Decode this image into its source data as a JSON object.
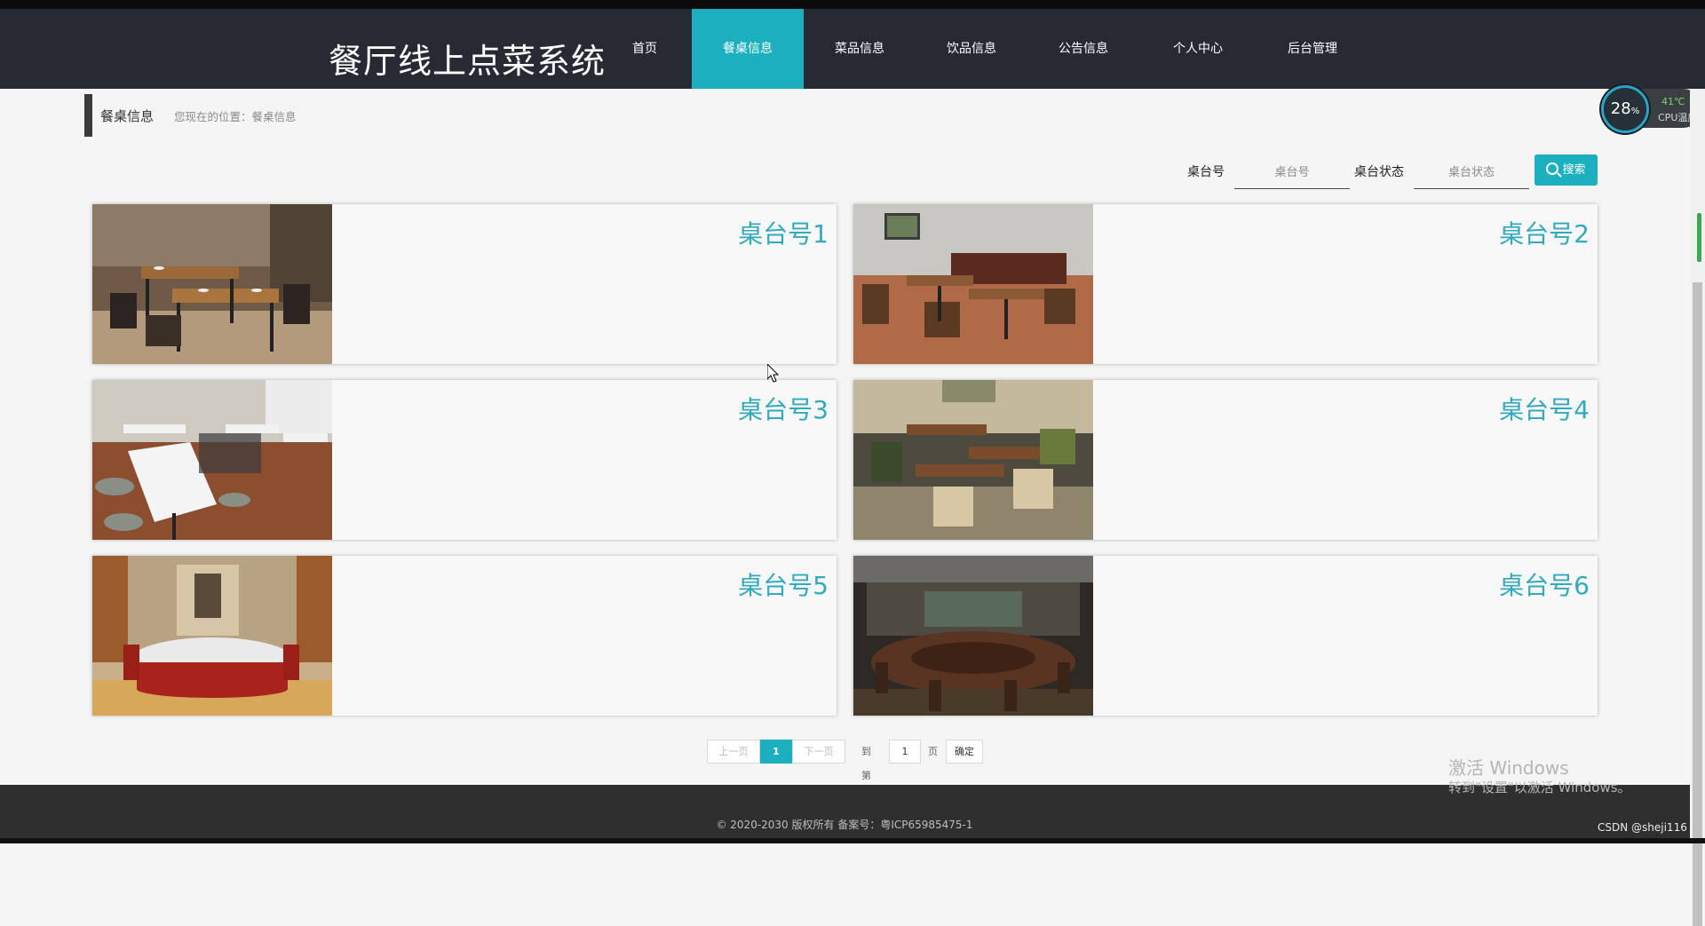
{
  "header": {
    "brand": "餐厅线上点菜系统",
    "nav": [
      "首页",
      "餐桌信息",
      "菜品信息",
      "饮品信息",
      "公告信息",
      "个人中心",
      "后台管理"
    ],
    "active_index": 1
  },
  "breadcrumb": {
    "title": "餐桌信息",
    "location": "您现在的位置：餐桌信息"
  },
  "search": {
    "table_label": "桌台号",
    "table_placeholder": "桌台号",
    "status_label": "桌台状态",
    "status_placeholder": "桌台状态",
    "button_label": "搜索",
    "button_icon": "search-icon"
  },
  "tables": [
    {
      "name": "桌台号1"
    },
    {
      "name": "桌台号2"
    },
    {
      "name": "桌台号3"
    },
    {
      "name": "桌台号4"
    },
    {
      "name": "桌台号5"
    },
    {
      "name": "桌台号6"
    }
  ],
  "pagination": {
    "prev": "上一页",
    "current": "1",
    "next": "下一页",
    "goto_prefix": "到第",
    "goto_value": "1",
    "goto_suffix": "页",
    "confirm": "确定"
  },
  "footer": {
    "copyright": "© 2020-2030 版权所有 备案号：粤ICP65985475-1"
  },
  "overlay": {
    "cpu_usage": "28",
    "cpu_usage_unit": "%",
    "cpu_temp": "41℃",
    "cpu_label": "CPU温度",
    "activate_title": "激活 Windows",
    "activate_sub": "转到\"设置\"以激活 Windows。",
    "csdn": "CSDN @sheji116"
  },
  "colors": {
    "accent": "#1cafc0",
    "header_bg": "#262b33",
    "table_name": "#31a9be"
  }
}
